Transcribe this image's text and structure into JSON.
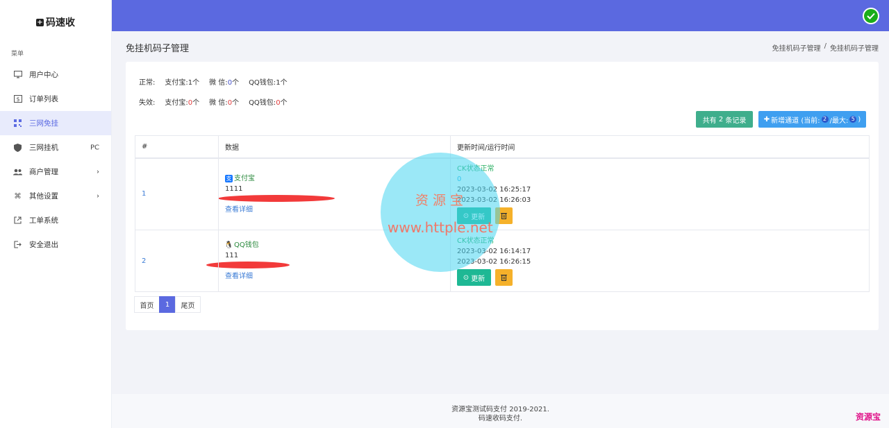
{
  "app": {
    "brand": "码速收",
    "brand_icon": "plus-square-icon"
  },
  "sidebar": {
    "menu_title": "菜单",
    "items": [
      {
        "label": "用户中心",
        "icon": "monitor-icon",
        "extra": ""
      },
      {
        "label": "订单列表",
        "icon": "dollar-box-icon",
        "extra": ""
      },
      {
        "label": "三网免挂",
        "icon": "qrcode-icon",
        "extra": "",
        "active": true
      },
      {
        "label": "三网挂机",
        "icon": "shield-icon",
        "extra": "PC"
      },
      {
        "label": "商户管理",
        "icon": "users-icon",
        "extra": "›"
      },
      {
        "label": "其他设置",
        "icon": "command-icon",
        "extra": "›"
      },
      {
        "label": "工单系统",
        "icon": "share-icon",
        "extra": ""
      },
      {
        "label": "安全退出",
        "icon": "logout-icon",
        "extra": ""
      }
    ]
  },
  "header": {
    "page_title": "免挂机码子管理",
    "breadcrumb": [
      "免挂机码子管理",
      "/",
      "免挂机码子管理"
    ]
  },
  "stats": {
    "normal": {
      "label": "正常:",
      "alipay": "支付宝:",
      "alipay_n": "1",
      "wechat": "微 信:",
      "wechat_n": "0",
      "qq": "QQ钱包:",
      "qq_n": "1",
      "unit": "个"
    },
    "invalid": {
      "label": "失效:",
      "alipay": "支付宝:",
      "alipay_n": "0",
      "wechat": "微 信:",
      "wechat_n": "0",
      "qq": "QQ钱包:",
      "qq_n": "0",
      "unit": "个"
    }
  },
  "actions": {
    "total_prefix": "共有",
    "total_count": "2",
    "total_suffix": "条记录",
    "add_label": "新增通道 (当前:",
    "add_current": "2",
    "add_max_label": "/最大:",
    "add_max": "5",
    "add_close": ")"
  },
  "table": {
    "headers": [
      "#",
      "数据",
      "更新时间/运行时间"
    ],
    "rows": [
      {
        "index": "1",
        "pay_type": "支付宝",
        "account": "1111",
        "detail": "查看详细",
        "status": "CK状态正常",
        "count": "0",
        "time1": "2023-03-02 16:25:17",
        "time2": "2023-03-02 16:26:03",
        "update": "更新"
      },
      {
        "index": "2",
        "pay_type": "QQ钱包",
        "account": "111",
        "detail": "查看详细",
        "status": "CK状态正常",
        "count": "",
        "time1": "2023-03-02 16:14:17",
        "time2": "2023-03-02 16:26:15",
        "update": "更新"
      }
    ]
  },
  "pager": {
    "first": "首页",
    "current": "1",
    "last": "尾页"
  },
  "watermark": {
    "title": "资源宝",
    "url": "www.httple.net"
  },
  "footer": {
    "line1": "资源宝测试码支付 2019-2021.",
    "line2": "码速收码支付.",
    "corner": "资源宝"
  },
  "colors": {
    "primary": "#5b69e0",
    "success": "#3fae8c",
    "info": "#3f9ff0",
    "warning": "#f5b12a"
  }
}
